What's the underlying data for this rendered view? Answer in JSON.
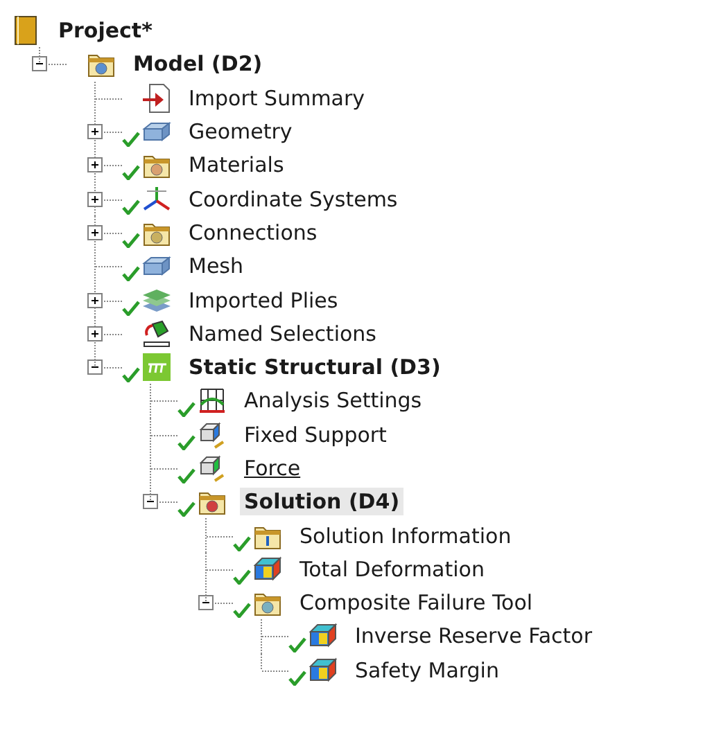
{
  "tree": {
    "label": "Project*",
    "kind": "book",
    "bold": true,
    "checked": false,
    "selected": false,
    "children": [
      {
        "label": "Model (D2)",
        "kind": "folder-model",
        "bold": true,
        "checked": false,
        "selected": false,
        "expanded": true,
        "children": [
          {
            "label": "Import Summary",
            "kind": "import",
            "bold": false,
            "checked": false,
            "selected": false
          },
          {
            "label": "Geometry",
            "kind": "blocks",
            "bold": false,
            "checked": true,
            "selected": false,
            "expanded": false
          },
          {
            "label": "Materials",
            "kind": "folder-materials",
            "bold": false,
            "checked": true,
            "selected": false,
            "expanded": false
          },
          {
            "label": "Coordinate Systems",
            "kind": "axes",
            "bold": false,
            "checked": true,
            "selected": false,
            "expanded": false
          },
          {
            "label": "Connections",
            "kind": "folder-connections",
            "bold": false,
            "checked": true,
            "selected": false,
            "expanded": false
          },
          {
            "label": "Mesh",
            "kind": "mesh",
            "bold": false,
            "checked": true,
            "selected": false
          },
          {
            "label": "Imported Plies",
            "kind": "layers",
            "bold": false,
            "checked": true,
            "selected": false,
            "expanded": false
          },
          {
            "label": "Named Selections",
            "kind": "named",
            "bold": false,
            "checked": false,
            "selected": false,
            "expanded": false
          },
          {
            "label": "Static Structural (D3)",
            "kind": "structural",
            "bold": true,
            "checked": true,
            "selected": false,
            "expanded": true,
            "children": [
              {
                "label": "Analysis Settings",
                "kind": "analysis",
                "bold": false,
                "checked": true,
                "selected": false
              },
              {
                "label": "Fixed Support",
                "kind": "support",
                "bold": false,
                "checked": true,
                "selected": false
              },
              {
                "label": "Force",
                "kind": "force",
                "bold": false,
                "checked": true,
                "selected": false,
                "underlined": true
              },
              {
                "label": "Solution (D4)",
                "kind": "folder-solution",
                "bold": true,
                "checked": true,
                "selected": true,
                "expanded": true,
                "children": [
                  {
                    "label": "Solution Information",
                    "kind": "folder-info",
                    "bold": false,
                    "checked": true,
                    "selected": false
                  },
                  {
                    "label": "Total Deformation",
                    "kind": "result",
                    "bold": false,
                    "checked": true,
                    "selected": false
                  },
                  {
                    "label": "Composite Failure Tool",
                    "kind": "folder-composite",
                    "bold": false,
                    "checked": true,
                    "selected": false,
                    "expanded": true,
                    "children": [
                      {
                        "label": "Inverse Reserve Factor",
                        "kind": "result",
                        "bold": false,
                        "checked": true,
                        "selected": false
                      },
                      {
                        "label": "Safety Margin",
                        "kind": "result",
                        "bold": false,
                        "checked": true,
                        "selected": false
                      }
                    ]
                  }
                ]
              }
            ]
          }
        ]
      }
    ]
  }
}
